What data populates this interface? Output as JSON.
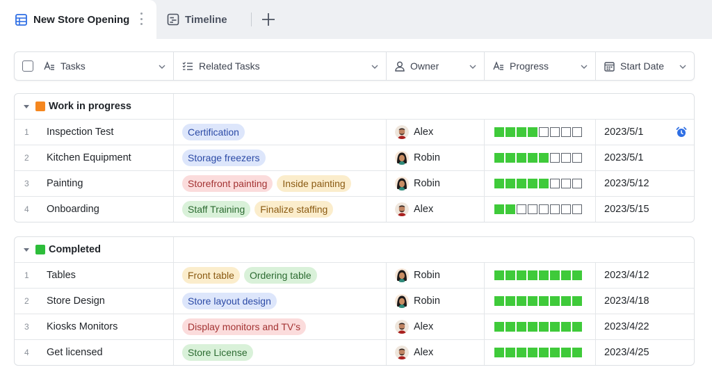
{
  "tabs": [
    {
      "label": "New Store Opening",
      "icon": "table-icon",
      "active": true
    },
    {
      "label": "Timeline",
      "icon": "timeline-icon",
      "active": false
    }
  ],
  "columns": [
    {
      "label": "Tasks",
      "icon": "text-field-icon"
    },
    {
      "label": "Related Tasks",
      "icon": "checklist-icon"
    },
    {
      "label": "Owner",
      "icon": "person-icon"
    },
    {
      "label": "Progress",
      "icon": "text-field-icon"
    },
    {
      "label": "Start Date",
      "icon": "calendar-icon"
    }
  ],
  "progress_total": 8,
  "groups": [
    {
      "title": "Work in progress",
      "color": "#f5871f",
      "rows": [
        {
          "num": "1",
          "task": "Inspection Test",
          "related": [
            {
              "label": "Certification",
              "color": "blue"
            }
          ],
          "owner": "Alex",
          "avatar": "alex",
          "progress": 4,
          "date": "2023/5/1",
          "alarm": true
        },
        {
          "num": "2",
          "task": "Kitchen Equipment",
          "related": [
            {
              "label": "Storage freezers",
              "color": "blue"
            }
          ],
          "owner": "Robin",
          "avatar": "robin",
          "progress": 5,
          "date": "2023/5/1",
          "alarm": false
        },
        {
          "num": "3",
          "task": "Painting",
          "related": [
            {
              "label": "Storefront painting",
              "color": "red"
            },
            {
              "label": "Inside painting",
              "color": "yellow"
            }
          ],
          "owner": "Robin",
          "avatar": "robin",
          "progress": 5,
          "date": "2023/5/12",
          "alarm": false
        },
        {
          "num": "4",
          "task": "Onboarding",
          "related": [
            {
              "label": "Staff Training",
              "color": "green"
            },
            {
              "label": "Finalize staffing",
              "color": "yellow"
            }
          ],
          "owner": "Alex",
          "avatar": "alex",
          "progress": 2,
          "date": "2023/5/15",
          "alarm": false
        }
      ]
    },
    {
      "title": "Completed",
      "color": "#2dbd3a",
      "rows": [
        {
          "num": "1",
          "task": "Tables",
          "related": [
            {
              "label": "Front table",
              "color": "yellow"
            },
            {
              "label": "Ordering table",
              "color": "green"
            }
          ],
          "owner": "Robin",
          "avatar": "robin",
          "progress": 8,
          "date": "2023/4/12",
          "alarm": false
        },
        {
          "num": "2",
          "task": "Store Design",
          "related": [
            {
              "label": "Store layout design",
              "color": "blue"
            }
          ],
          "owner": "Robin",
          "avatar": "robin",
          "progress": 8,
          "date": "2023/4/18",
          "alarm": false
        },
        {
          "num": "3",
          "task": "Kiosks Monitors",
          "related": [
            {
              "label": "Display monitors and TV’s",
              "color": "red"
            }
          ],
          "owner": "Alex",
          "avatar": "alex",
          "progress": 8,
          "date": "2023/4/22",
          "alarm": false
        },
        {
          "num": "4",
          "task": "Get licensed",
          "related": [
            {
              "label": "Store License",
              "color": "green"
            }
          ],
          "owner": "Alex",
          "avatar": "alex",
          "progress": 8,
          "date": "2023/4/25",
          "alarm": false
        }
      ]
    }
  ]
}
